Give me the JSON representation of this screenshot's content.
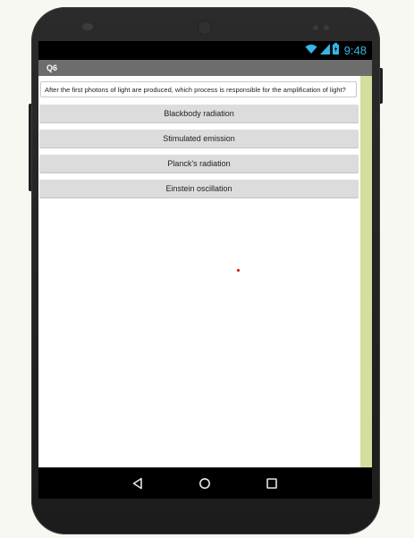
{
  "status_bar": {
    "time": "9:48",
    "icons": [
      "wifi-icon",
      "signal-icon",
      "battery-icon"
    ],
    "icon_color": "#35b6e6"
  },
  "app": {
    "title": "Q6",
    "title_bar_color": "#6d6d6d",
    "side_bar_color": "#d3df9f"
  },
  "question": {
    "text": "After the first photons of light are produced, which process is responsible for the amplification of light?"
  },
  "answers": [
    {
      "label": "Blackbody radiation"
    },
    {
      "label": "Stimulated emission"
    },
    {
      "label": "Planck's radiation"
    },
    {
      "label": "Einstein oscillation"
    }
  ],
  "nav_bar": {
    "buttons": [
      "back-icon",
      "home-icon",
      "recent-apps-icon"
    ]
  }
}
